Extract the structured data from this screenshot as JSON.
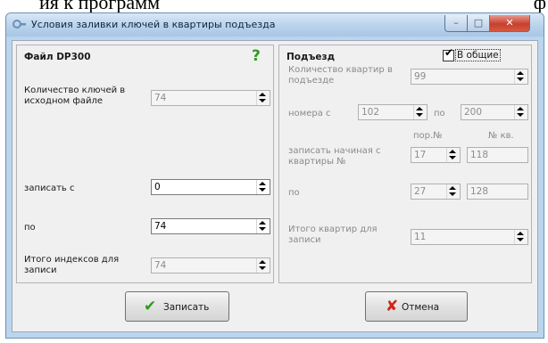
{
  "window": {
    "title": "Условия заливки ключей в квартиры подъезда",
    "min": "–",
    "max": "□",
    "close": "✕"
  },
  "left": {
    "header": "Файл DP300",
    "help": "?",
    "keys_in_file_label": "Количество ключей в исходном файле",
    "keys_in_file_value": "74",
    "write_from_label": "записать с",
    "write_from_value": "0",
    "to_label": "по",
    "to_value": "74",
    "total_label": "Итого индексов для записи",
    "total_value": "74"
  },
  "right": {
    "header": "Подъезд",
    "common_label": "В общие",
    "common_checked": true,
    "checkmark": "✔",
    "apartments_count_label": "Количество квартир в подъезде",
    "apartments_count_value": "99",
    "numbers_from_label": "номера с",
    "numbers_from_value": "102",
    "numbers_to_label": "по",
    "numbers_to_value": "200",
    "col_seq": "пор.№",
    "col_apt": "№ кв.",
    "start_label": "записать начиная с квартиры №",
    "start_seq": "17",
    "start_apt": "118",
    "end_label": "по",
    "end_seq": "27",
    "end_apt": "128",
    "total_label": "Итого квартир для записи",
    "total_value": "11"
  },
  "buttons": {
    "write_label": "Записать",
    "cancel_label": "Отмена",
    "write_icon": "✔",
    "cancel_icon": "✘"
  },
  "background": {
    "left_fragment": "ия к программ",
    "right_fragment": "ф"
  },
  "colors": {
    "title_bar": "#bcd5ee",
    "close_button": "#c7402e",
    "check_green": "#2e9a1c",
    "cancel_red": "#d22418"
  }
}
